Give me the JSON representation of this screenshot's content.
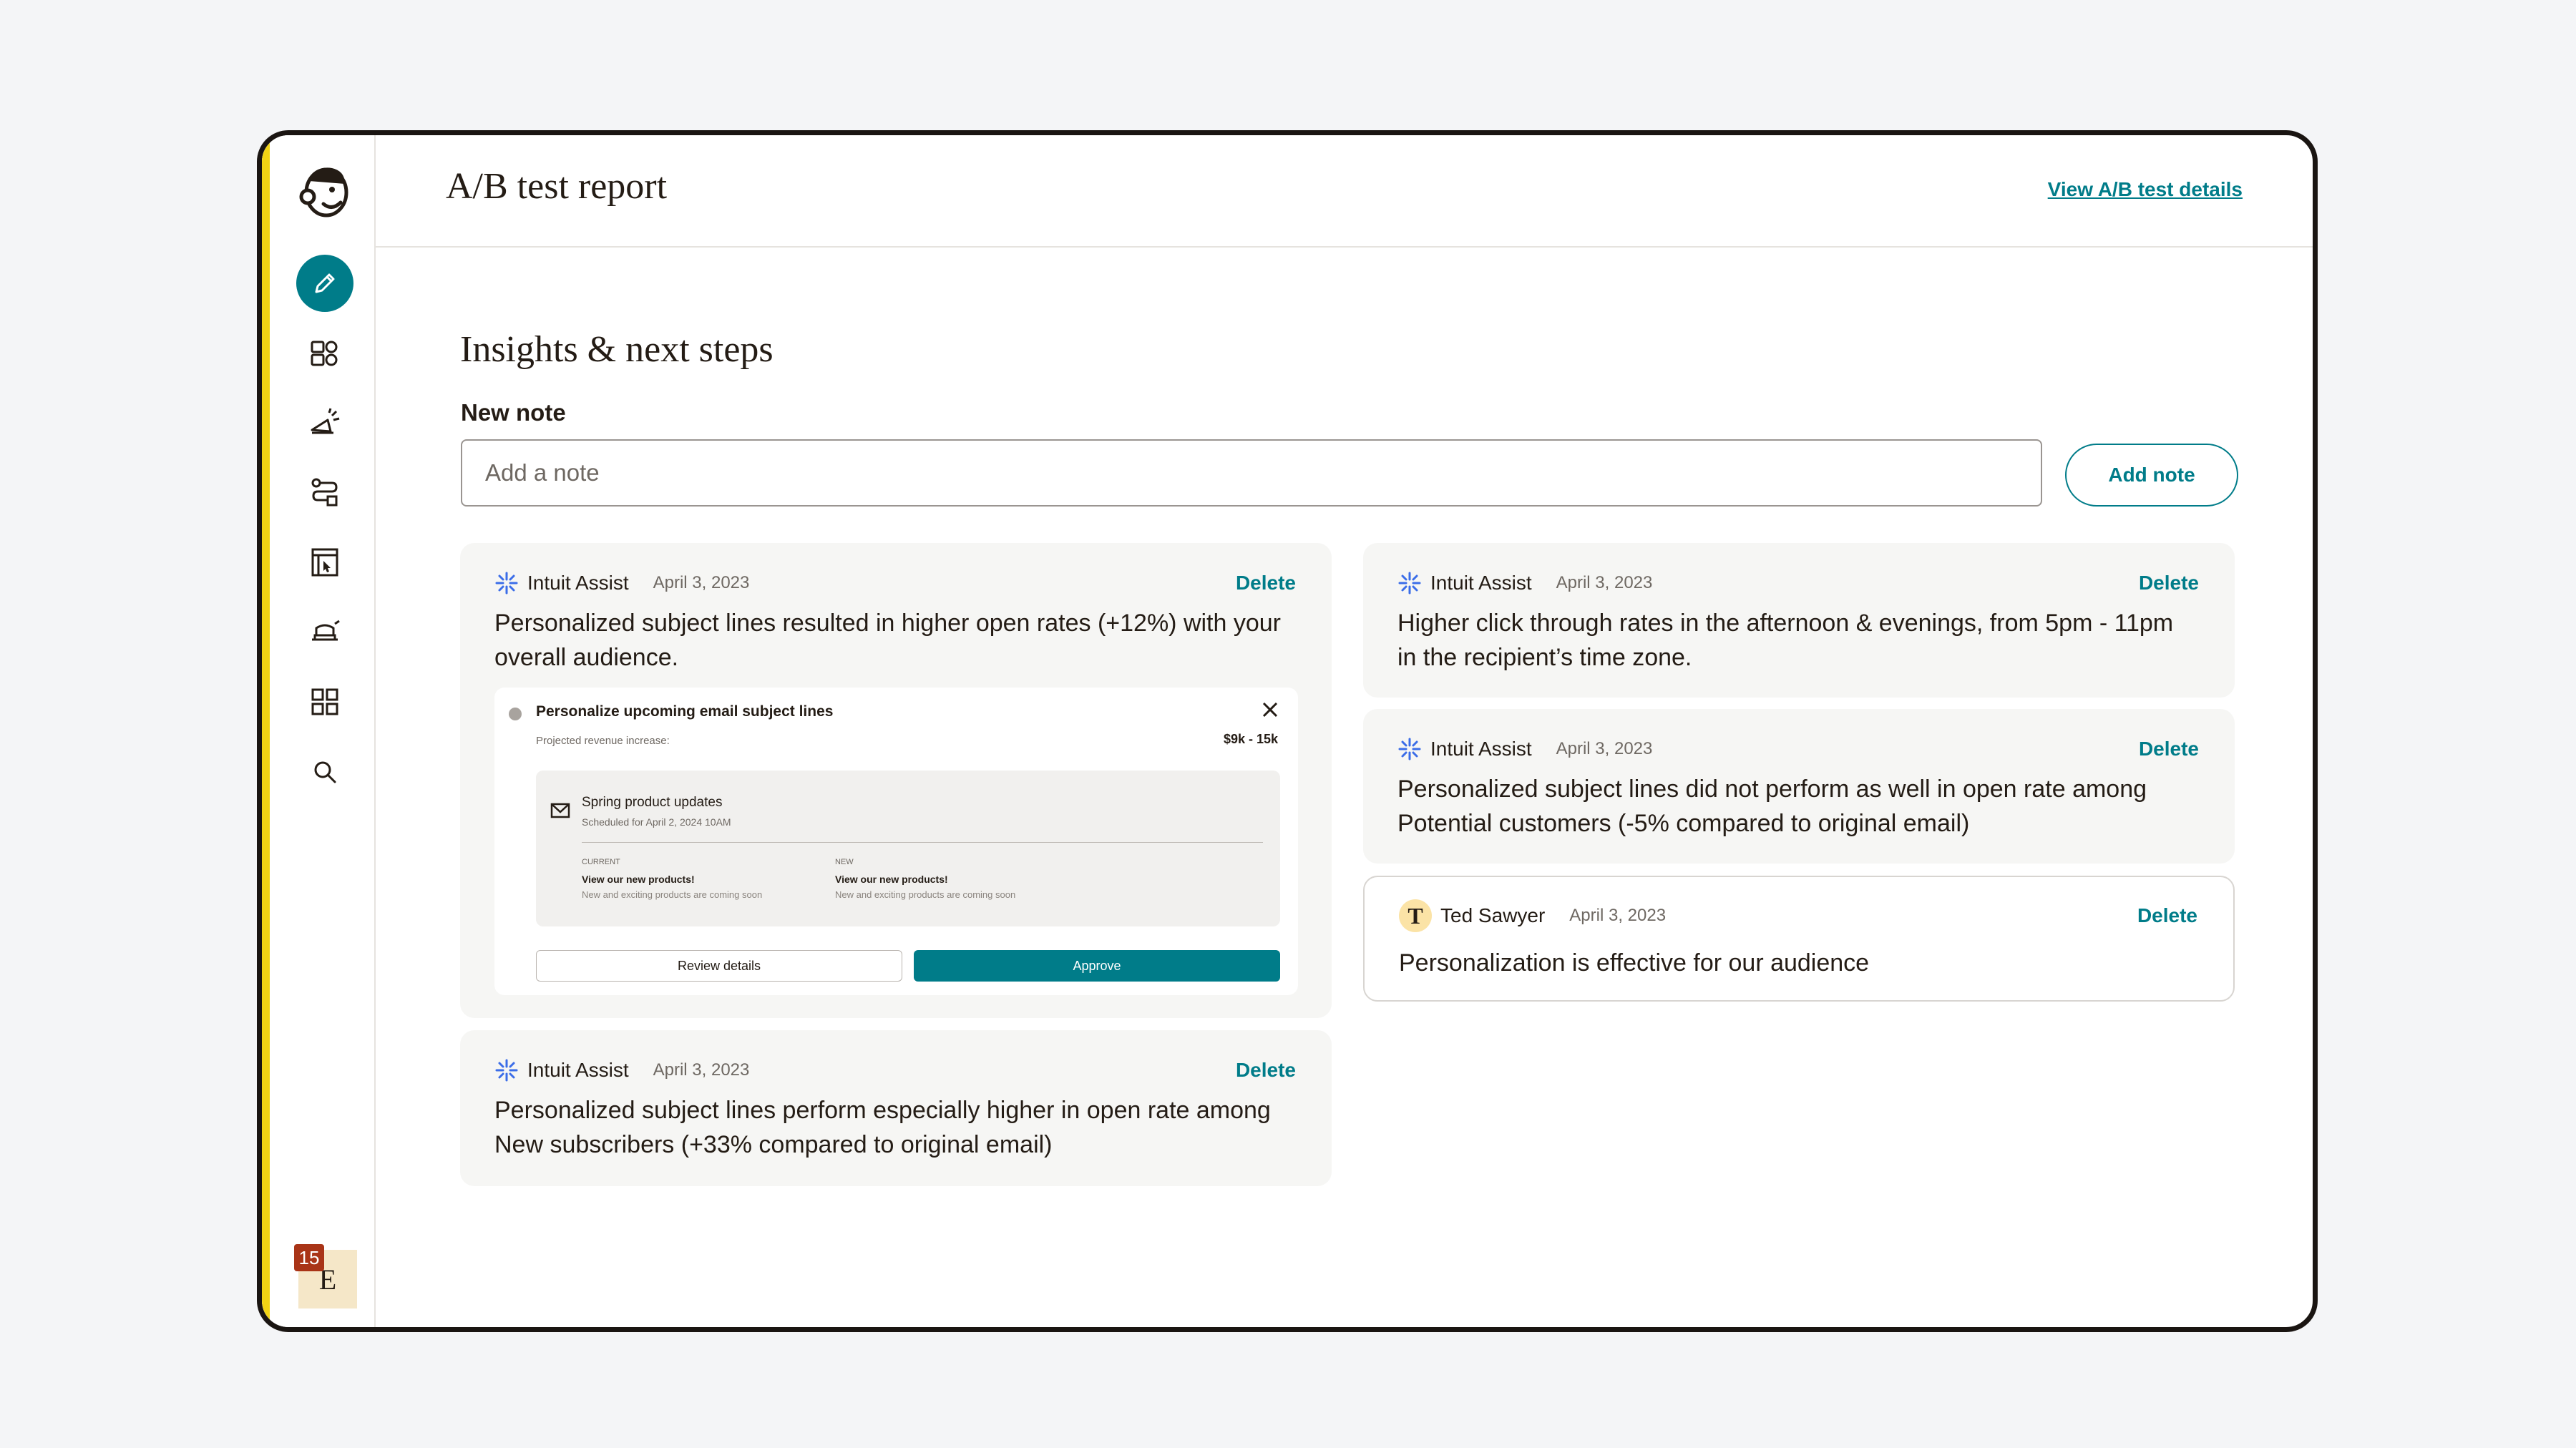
{
  "header": {
    "title": "A/B test report",
    "view_link": "View A/B test details"
  },
  "sidebar": {
    "items": [
      {
        "icon": "pencil-icon",
        "active": true
      },
      {
        "icon": "audience-icon"
      },
      {
        "icon": "megaphone-icon"
      },
      {
        "icon": "automation-icon"
      },
      {
        "icon": "website-icon"
      },
      {
        "icon": "integrations-icon"
      },
      {
        "icon": "apps-grid-icon"
      },
      {
        "icon": "search-icon"
      }
    ],
    "account": {
      "initial": "E",
      "notification_count": "15"
    }
  },
  "main": {
    "section_title": "Insights & next steps",
    "new_note_label": "New note",
    "note_placeholder": "Add a note",
    "add_note_label": "Add note"
  },
  "cards": [
    {
      "author": "Intuit Assist",
      "date": "April 3, 2023",
      "delete_label": "Delete",
      "text": "Personalized subject lines resulted in higher open rates (+12%) with your overall audience.",
      "preview": {
        "title": "Personalize upcoming email subject lines",
        "subtitle": "Projected revenue increase:",
        "range": "$9k - 15k",
        "campaign_name": "Spring product updates",
        "scheduled": "Scheduled for April 2, 2024 10AM",
        "current_label": "CURRENT",
        "current_subject": "View our new products!",
        "current_preview": "New and exciting products are coming soon",
        "new_label": "NEW",
        "new_subject": "View our new products!",
        "new_preview": "New and exciting products are coming soon",
        "review_label": "Review details",
        "approve_label": "Approve"
      }
    },
    {
      "author": "Intuit Assist",
      "date": "April 3, 2023",
      "delete_label": "Delete",
      "text": "Personalized subject lines perform especially higher in open rate among New subscribers (+33% compared to original email)"
    },
    {
      "author": "Intuit Assist",
      "date": "April 3, 2023",
      "delete_label": "Delete",
      "text": "Higher click through rates in the afternoon & evenings, from 5pm - 11pm in the recipient’s time zone."
    },
    {
      "author": "Intuit Assist",
      "date": "April 3, 2023",
      "delete_label": "Delete",
      "text": "Personalized subject lines did not perform as well in open rate among Potential customers (-5% compared to original email)"
    },
    {
      "author": "Ted Sawyer",
      "author_initial": "T",
      "date": "April 3, 2023",
      "delete_label": "Delete",
      "text": "Personalization is effective for our audience"
    }
  ],
  "colors": {
    "accent": "#007c89",
    "brand_yellow": "#f2d414",
    "badge": "#a93417",
    "card_bg": "#f6f6f4"
  }
}
